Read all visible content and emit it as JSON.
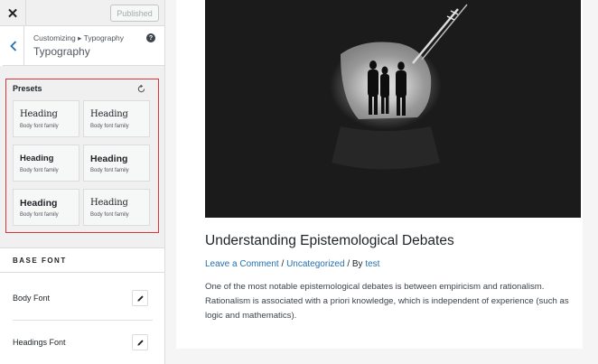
{
  "topbar": {
    "close_label": "✕",
    "published_label": "Published"
  },
  "section": {
    "breadcrumb": "Customizing ▸ Typography",
    "title": "Typography",
    "help_label": "?"
  },
  "presets": {
    "label": "Presets",
    "reset_icon": "reset-icon",
    "cards": [
      {
        "heading": "Heading",
        "body": "Body font family"
      },
      {
        "heading": "Heading",
        "body": "Body font family"
      },
      {
        "heading": "Heading",
        "body": "Body font family"
      },
      {
        "heading": "Heading",
        "body": "Body font family"
      },
      {
        "heading": "Heading",
        "body": "Body font family"
      },
      {
        "heading": "Heading",
        "body": "Body font family"
      }
    ]
  },
  "base_font": {
    "label": "BASE FONT",
    "rows": [
      {
        "label": "Body Font"
      },
      {
        "label": "Headings Font"
      }
    ]
  },
  "post": {
    "title": "Understanding Epistemological Debates",
    "meta": {
      "comment_link": "Leave a Comment",
      "sep1": " / ",
      "category_link": "Uncategorized",
      "sep2": " / By ",
      "author_link": "test"
    },
    "body": "One of the most notable epistemological debates is between empiricism and rationalism. Rationalism is associated with a priori knowledge, which is independent of experience (such as logic and mathematics)."
  },
  "colors": {
    "accent": "#2271b1",
    "highlight_border": "#d63638"
  }
}
